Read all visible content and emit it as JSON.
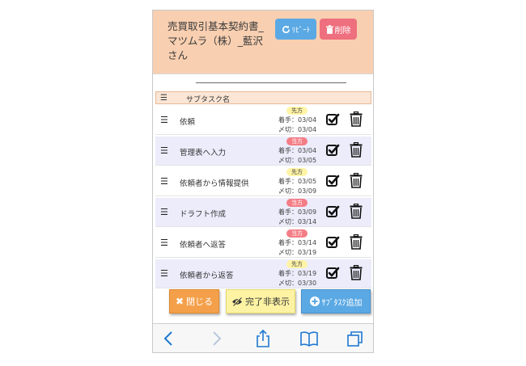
{
  "header": {
    "title": "売買取引基本契約書_マツムラ（株）_藍沢さん",
    "repeat_label": "ﾘﾋﾟｰﾄ",
    "delete_label": "削除",
    "colors": {
      "background": "#f8cfb0",
      "repeat": "#5ba9e4",
      "delete": "#ee6f7e"
    }
  },
  "table": {
    "column_header": "サブタスク名",
    "rows": [
      {
        "name": "依頼",
        "priority": "先方",
        "start": "着手：03/04",
        "due": "〆切：03/04"
      },
      {
        "name": "管理表へ入力",
        "priority": "当方",
        "start": "着手：03/04",
        "due": "〆切：03/05"
      },
      {
        "name": "依頼者から情報提供",
        "priority": "先方",
        "start": "着手：03/05",
        "due": "〆切：03/09"
      },
      {
        "name": "ドラフト作成",
        "priority": "当方",
        "start": "着手：03/09",
        "due": "〆切：03/14"
      },
      {
        "name": "依頼者へ返答",
        "priority": "当方",
        "start": "着手：03/14",
        "due": "〆切：03/19"
      },
      {
        "name": "依頼者から返答",
        "priority": "先方",
        "start": "着手：03/19",
        "due": "〆切：03/30"
      }
    ]
  },
  "actions": {
    "close_label": "閉じる",
    "hide_done_label": "完了非表示",
    "add_subtask_label": "ｻﾌﾞﾀｽｸ追加"
  },
  "browser_toolbar": {
    "icons": [
      "back-icon",
      "forward-icon",
      "share-icon",
      "bookmarks-icon",
      "tabs-icon"
    ]
  }
}
